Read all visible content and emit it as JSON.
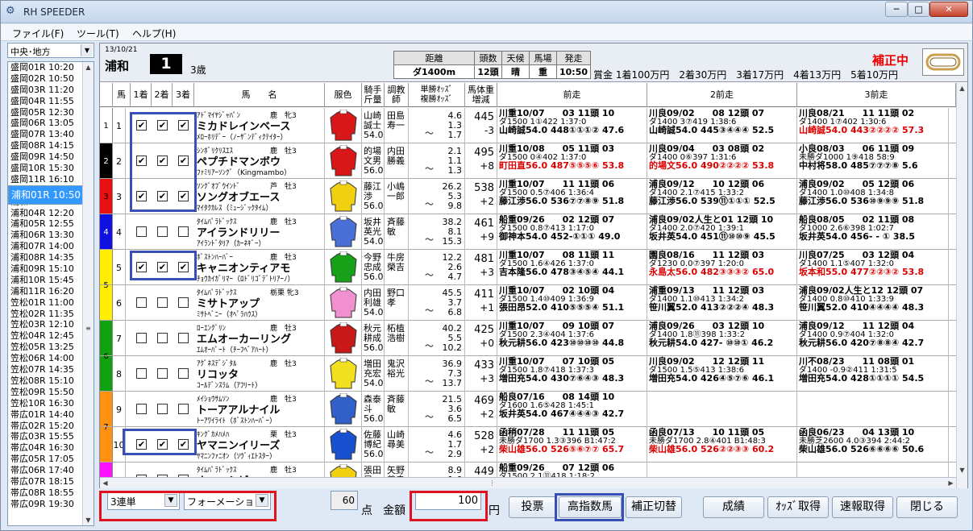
{
  "window": {
    "title": "RH SPEEDER",
    "minimize": "─",
    "maximize": "□",
    "close": "✕",
    "icon": "app-logo-icon"
  },
  "menu": {
    "file": "ファイル(F)",
    "tools": "ツール(T)",
    "help": "ヘルプ(H)"
  },
  "left": {
    "region": "中央･地方",
    "races": [
      "盛岡01R 10:20",
      "盛岡02R 10:50",
      "盛岡03R 11:20",
      "盛岡04R 11:55",
      "盛岡05R 12:30",
      "盛岡06R 13:05",
      "盛岡07R 13:40",
      "盛岡08R 14:15",
      "盛岡09R 14:50",
      "盛岡10R 15:30",
      "盛岡11R 16:10",
      "浦和01R 10:50",
      "浦和02R 11:20",
      "浦和03R 11:50",
      "浦和04R 12:20",
      "浦和05R 12:55",
      "浦和06R 13:30",
      "浦和07R 14:00",
      "浦和08R 14:35",
      "浦和09R 15:10",
      "浦和10R 15:45",
      "浦和11R 16:20",
      "笠松01R 11:00",
      "笠松02R 11:35",
      "笠松03R 12:10",
      "笠松04R 12:45",
      "笠松05R 13:25",
      "笠松06R 14:00",
      "笠松07R 14:35",
      "笠松08R 15:10",
      "笠松09R 15:50",
      "笠松10R 16:30",
      "帯広01R 14:40",
      "帯広02R 15:20",
      "帯広03R 15:55",
      "帯広04R 16:30",
      "帯広05R 17:05",
      "帯広06R 17:40",
      "帯広07R 18:15",
      "帯広08R 18:55",
      "帯広09R 19:30"
    ],
    "selected_index": 11
  },
  "race": {
    "date": "13/10/21",
    "course": "浦和",
    "number": "1",
    "class": "3歳",
    "info_headers": [
      "距離",
      "頭数",
      "天候",
      "馬場",
      "発走"
    ],
    "info_values": [
      "ダ1400m",
      "12頭",
      "晴",
      "重",
      "10:50"
    ],
    "prize": "賞金 1着100万円　2着30万円　3着17万円　4着13万円　5着10万円",
    "hosei": "補正中"
  },
  "columns": {
    "waku": "",
    "uma": "馬",
    "c1": "1着",
    "c2": "2着",
    "c3": "3着",
    "name": "馬　　名",
    "silks": "服色",
    "jockey": "騎手\n斤量",
    "trainer": "調教\n師",
    "odds": "単勝ｵｯｽﾞ\n複勝ｵｯｽﾞ",
    "weight": "馬体重\n増減",
    "past1": "前走",
    "past2": "2前走",
    "past3": "3前走"
  },
  "horses": [
    {
      "waku": "1",
      "waku_color": "#ffffff",
      "num": "1",
      "c": [
        true,
        true,
        true
      ],
      "sire": "ｱﾄﾞﾏｲﾔｼﾞｬﾊﾟﾝ",
      "meta": "鹿　牝3",
      "name": "ミカドレインベース",
      "dam": "ﾒﾛｰﾎﾘﾃﾞｰ（ﾉｰｻﾞﾝﾃﾞｨｸﾃｲﾀｰ）",
      "jockey": [
        "山崎",
        "誠士",
        "54.0"
      ],
      "trainer": [
        "田島",
        "寿一"
      ],
      "odds": [
        "4.6",
        "1.3",
        "1.7"
      ],
      "weight": "445",
      "diff": "-3",
      "past": [
        [
          "川重10/07　　03 11頭 10",
          "ダ1500 1①422 1:37:0",
          "山崎誠54.0 448①①①② 47.6",
          ""
        ],
        [
          "川良09/02　　08 12頭 07",
          "ダ1400 3⑦419 1:38:6",
          "山崎誠54.0 445③④④④ 52.5",
          ""
        ],
        [
          "川良08/21　　11 11頭 02",
          "ダ1400 1⑦402 1:30:6",
          "山崎誠54.0 443②②②② 57.3",
          "red"
        ]
      ]
    },
    {
      "waku": "2",
      "waku_color": "#000000",
      "num": "2",
      "c": [
        true,
        true,
        true
      ],
      "sire": "ｼﾝﾎﾞﾘｸﾘｽｴｽ",
      "meta": "鹿　牡3",
      "name": "ペプチドマンボウ",
      "dam": "ﾌｧﾐﾘｱｰｿﾝｸﾞ（Kingmambo）",
      "jockey": [
        "的場",
        "文男",
        "56.0"
      ],
      "trainer": [
        "内田",
        "勝義"
      ],
      "odds": [
        "2.1",
        "1.1",
        "1.3"
      ],
      "weight": "495",
      "diff": "+8",
      "past": [
        [
          "川重10/08　　05 11頭 03",
          "ダ1500 0④402 1:37:0",
          "町田直56.0 487⑤⑤⑤⑥ 53.8",
          "red"
        ],
        [
          "川良09/04　　03 08頭 02",
          "ダ1400 0⑥397 1:31:6",
          "的場文56.0 490②②②② 53.8",
          "red"
        ],
        [
          "小良08/03　　06 11頭 09",
          "未勝ダ1000 1⑨418 58:9",
          "中村将58.0 485⑦⑦⑦⑧ 5.6",
          ""
        ]
      ]
    },
    {
      "waku": "3",
      "waku_color": "#e81010",
      "num": "3",
      "c": [
        true,
        true,
        true
      ],
      "sire": "ｿﾝｸﾞｵﾌﾞｳｲﾝﾄﾞ",
      "meta": "芦　牡3",
      "name": "ソングオブエース",
      "dam": "ﾏｲﾀｸｶﾚｽ（ﾐｭｰｼﾞｯｸﾀｲﾑ）",
      "jockey": [
        "藤江",
        "渉",
        "56.0"
      ],
      "trainer": [
        "小嶋",
        "一郎"
      ],
      "odds": [
        "26.2",
        "5.3",
        "9.8"
      ],
      "weight": "538",
      "diff": "+2",
      "past": [
        [
          "川重10/07　　11 11頭 06",
          "ダ1500 0.5⑦406 1:36:4",
          "藤江渉56.0 536⑦⑦⑧⑨ 51.8",
          ""
        ],
        [
          "浦良09/12　　10 12頭 06",
          "ダ1400 2.1⑦415 1:33:2",
          "藤江渉56.0 539⑪①①① 52.5",
          ""
        ],
        [
          "浦良09/02　　05 12頭 06",
          "ダ1400 1.0⑩408 1:34:8",
          "藤江渉56.0 536⑩⑨⑨⑨ 51.8",
          ""
        ]
      ]
    },
    {
      "waku": "4",
      "waku_color": "#1010e0",
      "num": "4",
      "c": [
        false,
        false,
        false
      ],
      "sire": "ﾀｲﾑﾊﾟﾗﾄﾞｯｸｽ",
      "meta": "鹿　牡3",
      "name": "アイランドリリー",
      "dam": "ｱｲﾗﾝﾄﾞﾀﾘｱ（ｶｰﾈｷﾞｰ）",
      "jockey": [
        "坂井",
        "英光",
        "54.0"
      ],
      "trainer": [
        "斉藤",
        "敏"
      ],
      "odds": [
        "38.2",
        "8.1",
        "15.3"
      ],
      "weight": "461",
      "diff": "+9",
      "past": [
        [
          "船重09/26　　02 12頭 07",
          "ダ1500 0.8⑦413 1:17:0",
          "御神本54.0 452-①①① 49.0",
          ""
        ],
        [
          "浦良09/02人生と01 12頭 10",
          "ダ1400 2.0⑦420 1:39:1",
          "坂井英54.0 451⑪⑩⑩⑨ 45.5",
          ""
        ],
        [
          "船良08/05　　02 11頭 08",
          "ダ1000 2.6⑥398 1:02:7",
          "坂井英54.0 456- - ① 38.5",
          ""
        ]
      ]
    },
    {
      "waku": "5",
      "waku_color": "#ffee00",
      "num": "5",
      "c": [
        true,
        true,
        true
      ],
      "sire": "ﾎﾞｽﾄﾝﾊｰﾊﾞｰ",
      "meta": "鹿　牡3",
      "name": "キャニオンティアモ",
      "dam": "ﾁｮｳｶｲｶﾞﾘﾏｰ（ﾛﾄﾞﾘｺﾞﾃﾞﾄﾘｱｰﾉ）",
      "jockey": [
        "今野",
        "忠成",
        "56.0"
      ],
      "trainer": [
        "牛房",
        "榮吉"
      ],
      "odds": [
        "12.2",
        "2.6",
        "4.7"
      ],
      "weight": "481",
      "diff": "+3",
      "past": [
        [
          "川重10/07　　08 11頭 11",
          "ダ1500 1.6④426 1:37:0",
          "吉本隆56.0 478③④⑤④ 44.1",
          ""
        ],
        [
          "園良08/16　　11 12頭 03",
          "ダ1230 0.0⑦397 1:20:0",
          "永島太56.0 482③③③② 65.0",
          "red"
        ],
        [
          "川良07/25　　03 12頭 04",
          "ダ1400 1.1⑤407 1:32:0",
          "坂本和55.0 477②②③② 53.8",
          "red"
        ]
      ]
    },
    {
      "waku": "5",
      "waku_color": "#ffee00",
      "num": "6",
      "c": [
        false,
        false,
        false
      ],
      "sire": "ﾀｲﾑﾊﾟﾗﾄﾞｯｸｽ",
      "meta": "栃栗 牝3",
      "name": "ミサトアップ",
      "dam": "ﾐｻﾄﾍﾞﾆｰ（ｵﾍﾟﾗﾊｳｽ）",
      "jockey": [
        "内田",
        "利雄",
        "54.0"
      ],
      "trainer": [
        "野口",
        "孝"
      ],
      "odds": [
        "45.5",
        "3.7",
        "6.8"
      ],
      "weight": "411",
      "diff": "+1",
      "past": [
        [
          "川重10/07　　02 10頭 04",
          "ダ1500 1.4⑩409 1:36:9",
          "張田昂52.0 410⑤⑤⑤④ 51.1",
          ""
        ],
        [
          "浦重09/13　　11 12頭 03",
          "ダ1400 1.1⑩413 1:34:2",
          "笹川翼52.0 413②②②④ 48.3",
          ""
        ],
        [
          "浦良09/02人生と12 12頭 07",
          "ダ1400 0.8⑩410 1:33:9",
          "笹川翼52.0 410④④④④ 48.3",
          ""
        ]
      ]
    },
    {
      "waku": "6",
      "waku_color": "#10a010",
      "num": "7",
      "c": [
        false,
        false,
        false
      ],
      "sire": "ﾛｰｴﾝｸﾞﾘﾝ",
      "meta": "鹿　牡3",
      "name": "エムオーカーリング",
      "dam": "ｴﾑｵｰﾊﾟｰﾄ（ﾁｰﾌﾍﾞｱﾊｰﾄ）",
      "jockey": [
        "秋元",
        "耕成",
        "56.0"
      ],
      "trainer": [
        "柘植",
        "浩樹"
      ],
      "odds": [
        "40.2",
        "5.5",
        "10.2"
      ],
      "weight": "425",
      "diff": "+0",
      "past": [
        [
          "川重10/07　　09 10頭 07",
          "ダ1500 2.3④404 1:37:6",
          "秋元耕56.0 423⑩⑩⑩⑩ 44.8",
          ""
        ],
        [
          "浦良09/26　　03 12頭 10",
          "ダ1400 1.8⑪398 1:33:2",
          "秋元耕54.0 427- ⑩⑩① 46.2",
          ""
        ],
        [
          "浦良09/12　　11 12頭 04",
          "ダ1400 0.9⑦404 1:32:0",
          "秋元耕56.0 420⑦⑧⑧④ 42.7",
          ""
        ]
      ]
    },
    {
      "waku": "6",
      "waku_color": "#10a010",
      "num": "8",
      "c": [
        false,
        false,
        false
      ],
      "sire": "ｱｸﾞﾈｽﾃﾞｼﾞﾀﾙ",
      "meta": "鹿　牡3",
      "name": "リコッタ",
      "dam": "ｺｰﾙﾃﾞﾝｽﾗﾑ（ｱﾌﾘｰﾄ）",
      "jockey": [
        "増田",
        "充宏",
        "54.0"
      ],
      "trainer": [
        "鬼沢",
        "裕光"
      ],
      "odds": [
        "36.9",
        "7.3",
        "13.7"
      ],
      "weight": "433",
      "diff": "+3",
      "past": [
        [
          "川重10/07　　07 10頭 05",
          "ダ1500 1.8⑦418 1:37:3",
          "増田充54.0 430⑦⑥④③ 48.3",
          ""
        ],
        [
          "川良09/02　　12 12頭 11",
          "ダ1500 1.5⑤413 1:38:6",
          "増田充54.0 426④⑤⑦⑥ 46.1",
          ""
        ],
        [
          "川不08/23　　11 08頭 01",
          "ダ1400 -0.9②411 1:31:5",
          "増田充54.0 428①①①① 54.5",
          ""
        ]
      ]
    },
    {
      "waku": "7",
      "waku_color": "#ff9010",
      "num": "9",
      "c": [
        false,
        false,
        false
      ],
      "sire": "ﾒｲｼｮｳｻﾑｿﾝ",
      "meta": "鹿　牡3",
      "name": "トーアアルナイル",
      "dam": "ﾄｰｱﾜｲﾗｲﾄ（ﾎﾞｽﾄﾝﾊｰﾊﾞｰ）",
      "jockey": [
        "森泰",
        "斗",
        "56.0"
      ],
      "trainer": [
        "斉藤",
        "敏"
      ],
      "odds": [
        "21.5",
        "3.6",
        "6.5"
      ],
      "weight": "469",
      "diff": "+2",
      "past": [
        [
          "船良07/16　　08 14頭 10",
          "ダ1600 1.6⑤428 1:45:1",
          "坂井英54.0 467④④④③ 42.7",
          ""
        ],
        [
          "",
          "",
          " ",
          ""
        ],
        [
          "",
          "",
          "",
          " "
        ]
      ]
    },
    {
      "waku": "7",
      "waku_color": "#ff9010",
      "num": "10",
      "c": [
        true,
        true,
        true
      ],
      "sire": "ｷﾝｸﾞｶﾒﾊﾒﾊ",
      "meta": "栗　牡3",
      "name": "ヤマニンイリーズ",
      "dam": "ﾔﾏﾆﾝﾌｧﾆｵﾝ（ｿｳﾞｨｴﾄｽﾀｰ）",
      "jockey": [
        "佐藤",
        "博紀",
        "56.0"
      ],
      "trainer": [
        "山崎",
        "尋美"
      ],
      "odds": [
        "4.6",
        "1.7",
        "2.9"
      ],
      "weight": "528",
      "diff": "+2",
      "past": [
        [
          "函稍07/28　　11 11頭 05",
          "未勝ダ1700 1.3③396 B1:47:2",
          "柴山雄56.0 526⑤⑥⑦⑦ 65.7",
          "red"
        ],
        [
          "函良07/13　　10 11頭 05",
          "未勝ダ1700 2.8④401 B1:48:3",
          "柴山雄56.0 526②②③③ 60.2",
          "red"
        ],
        [
          "函良06/23　　04 13頭 10",
          "未勝芝2600 4.0③394 2:44:2",
          "柴山雄56.0 526⑥⑥⑥⑥ 50.6",
          ""
        ]
      ]
    },
    {
      "waku": "8",
      "waku_color": "#ff10ff",
      "num": "11",
      "c": [
        false,
        false,
        false
      ],
      "sire": "ﾀｲﾑﾊﾟﾗﾄﾞｯｸｽ",
      "meta": "鹿　牡3",
      "name": "ナェーシビュー",
      "dam": "",
      "jockey": [
        "張田",
        "昂",
        ""
      ],
      "trainer": [
        "矢野",
        "義幸"
      ],
      "odds": [
        "8.9",
        "1.6",
        ""
      ],
      "weight": "449",
      "diff": "",
      "past": [
        [
          "船重09/26　　07 12頭 06",
          "ダ1500 2.1⑪418 1:18:2",
          "",
          ""
        ],
        [
          "",
          "",
          "",
          ""
        ],
        [
          "",
          "",
          "",
          ""
        ]
      ]
    }
  ],
  "footer": {
    "bet_type": "3連単",
    "bet_method": "フォーメーション",
    "points": "60",
    "points_unit": "点",
    "amount_label": "金額",
    "amount": "100",
    "yen": "円",
    "vote": "投票",
    "high_index": "高指数馬",
    "hosei_toggle": "補正切替",
    "results": "成績",
    "odds_get": "ｵｯｽﾞ取得",
    "quick_get": "速報取得",
    "close": "閉じる"
  }
}
